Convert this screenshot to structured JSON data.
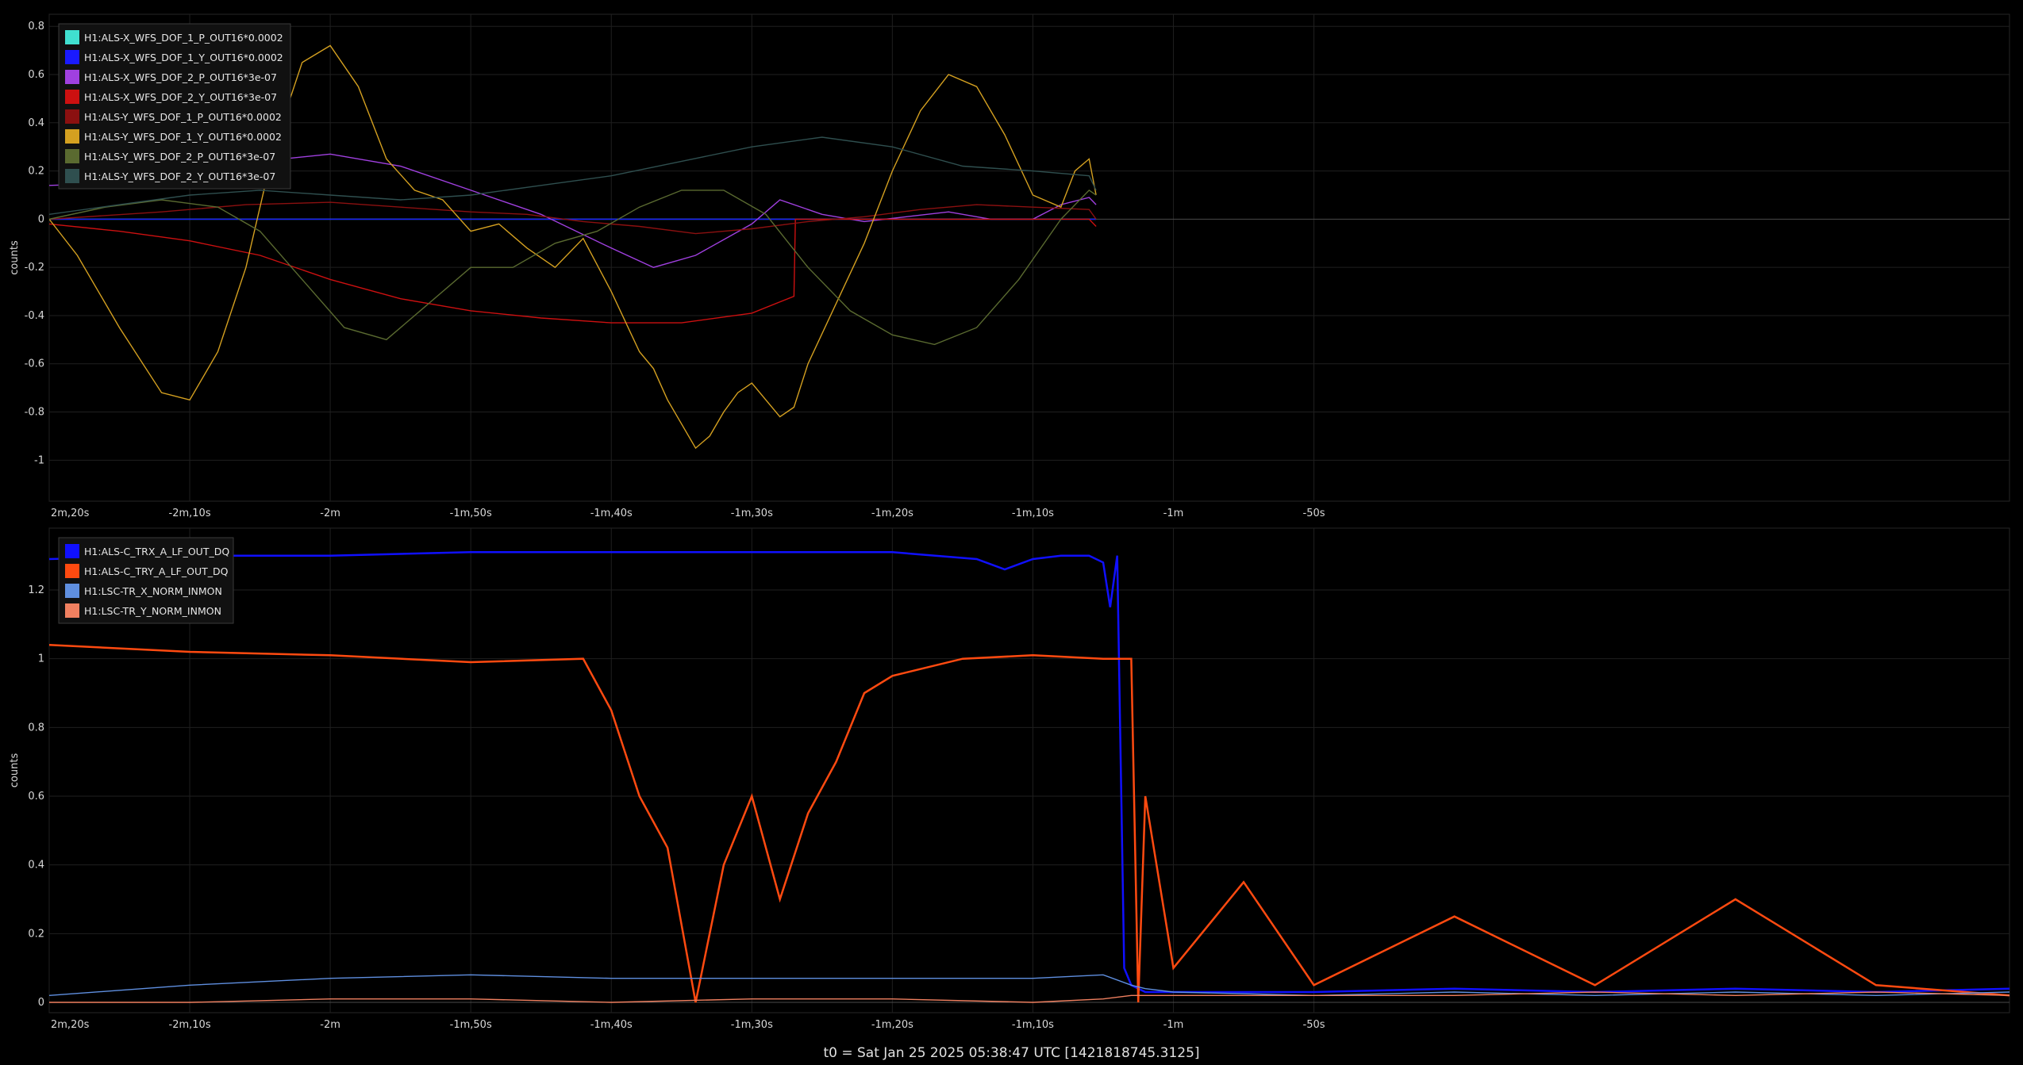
{
  "footer": {
    "t0": "t0 = Sat Jan 25 2025 05:38:47 UTC [1421818745.3125]"
  },
  "colors": {
    "background": "#000000",
    "grid": "#1f1f1f",
    "zero_line": "#4a4a4a",
    "axis_text": "#d8d8d8",
    "legend_bg": "#111111",
    "legend_border": "#3a3a3a"
  },
  "chart_data": [
    {
      "type": "line",
      "title": "",
      "ylabel": "counts",
      "xlim": [
        -140,
        -0.5
      ],
      "ylim": [
        -1.17,
        0.85
      ],
      "x_ticks": [
        -140,
        -130,
        -120,
        -110,
        -100,
        -90,
        -80,
        -70,
        -60,
        -50
      ],
      "x_tick_labels": [
        "2m,20s",
        "-2m,10s",
        "-2m",
        "-1m,50s",
        "-1m,40s",
        "-1m,30s",
        "-1m,20s",
        "-1m,10s",
        "-1m",
        "-50s"
      ],
      "y_ticks": [
        0.8,
        0.6,
        0.4,
        0.2,
        0,
        -0.2,
        -0.4,
        -0.6,
        -0.8,
        -1
      ],
      "y_tick_labels": [
        "0.8",
        "0.6",
        "0.4",
        "0.2",
        "0",
        "-0.2",
        "-0.4",
        "-0.6",
        "-0.8",
        "-1"
      ],
      "grid": true,
      "legend_position": "top-left",
      "series": [
        {
          "name": "H1:ALS-X_WFS_DOF_1_P_OUT16*0.0002",
          "color": "#40e0d0",
          "x": [
            -140,
            -65.5
          ],
          "y": [
            0.0,
            0.0
          ]
        },
        {
          "name": "H1:ALS-X_WFS_DOF_1_Y_OUT16*0.0002",
          "color": "#1a1aff",
          "x": [
            -140,
            -65.5
          ],
          "y": [
            0.0,
            0.0
          ]
        },
        {
          "name": "H1:ALS-X_WFS_DOF_2_P_OUT16*3e-07",
          "color": "#a040e0",
          "x": [
            -140,
            -135,
            -130,
            -125,
            -120,
            -115,
            -110,
            -105,
            -100,
            -97,
            -94,
            -90,
            -88,
            -85,
            -82,
            -79,
            -76,
            -73,
            -70,
            -68,
            -66,
            -65.5
          ],
          "y": [
            0.14,
            0.15,
            0.19,
            0.24,
            0.27,
            0.22,
            0.12,
            0.02,
            -0.12,
            -0.2,
            -0.15,
            -0.02,
            0.08,
            0.02,
            -0.01,
            0.01,
            0.03,
            0.0,
            0.0,
            0.06,
            0.09,
            0.06
          ]
        },
        {
          "name": "H1:ALS-X_WFS_DOF_2_Y_OUT16*3e-07",
          "color": "#cc1010",
          "x": [
            -140,
            -135,
            -130,
            -125,
            -120,
            -115,
            -110,
            -105,
            -100,
            -95,
            -90,
            -87,
            -86.9,
            -82,
            -78,
            -74,
            -70,
            -66,
            -65.5
          ],
          "y": [
            -0.02,
            -0.05,
            -0.09,
            -0.15,
            -0.25,
            -0.33,
            -0.38,
            -0.41,
            -0.43,
            -0.43,
            -0.39,
            -0.32,
            0.0,
            0.0,
            0.0,
            0.0,
            0.0,
            0.0,
            -0.03
          ]
        },
        {
          "name": "H1:ALS-Y_WFS_DOF_1_P_OUT16*0.0002",
          "color": "#8b1010",
          "x": [
            -140,
            -132,
            -126,
            -120,
            -115,
            -110,
            -106,
            -102,
            -98,
            -94,
            -90,
            -86,
            -82,
            -78,
            -74,
            -70,
            -66,
            -65.5
          ],
          "y": [
            0.0,
            0.03,
            0.06,
            0.07,
            0.05,
            0.03,
            0.02,
            -0.01,
            -0.03,
            -0.06,
            -0.04,
            -0.01,
            0.01,
            0.04,
            0.06,
            0.05,
            0.04,
            0.0
          ]
        },
        {
          "name": "H1:ALS-Y_WFS_DOF_1_Y_OUT16*0.0002",
          "color": "#d4a020",
          "x": [
            -140,
            -138,
            -135,
            -132,
            -130,
            -128,
            -126,
            -124,
            -122,
            -120,
            -118,
            -116,
            -114,
            -112,
            -110,
            -108,
            -106,
            -104,
            -102,
            -100,
            -98,
            -97,
            -96,
            -95,
            -94,
            -93,
            -92,
            -91,
            -90,
            -89,
            -88,
            -87,
            -86,
            -84,
            -82,
            -80,
            -78,
            -76,
            -74,
            -72,
            -70,
            -68,
            -67,
            -66,
            -65.5
          ],
          "y": [
            0.0,
            -0.15,
            -0.45,
            -0.72,
            -0.75,
            -0.55,
            -0.2,
            0.3,
            0.65,
            0.72,
            0.55,
            0.25,
            0.12,
            0.08,
            -0.05,
            -0.02,
            -0.12,
            -0.2,
            -0.08,
            -0.3,
            -0.55,
            -0.62,
            -0.75,
            -0.85,
            -0.95,
            -0.9,
            -0.8,
            -0.72,
            -0.68,
            -0.75,
            -0.82,
            -0.78,
            -0.6,
            -0.35,
            -0.1,
            0.2,
            0.45,
            0.6,
            0.55,
            0.35,
            0.1,
            0.05,
            0.2,
            0.25,
            0.1
          ]
        },
        {
          "name": "H1:ALS-Y_WFS_DOF_2_P_OUT16*3e-07",
          "color": "#5a6a30",
          "x": [
            -140,
            -136,
            -132,
            -128,
            -125,
            -122,
            -119,
            -116,
            -113,
            -110,
            -107,
            -104,
            -101,
            -98,
            -95,
            -92,
            -89,
            -86,
            -83,
            -80,
            -77,
            -74,
            -71,
            -68,
            -66,
            -65.5
          ],
          "y": [
            0.0,
            0.05,
            0.08,
            0.05,
            -0.05,
            -0.25,
            -0.45,
            -0.5,
            -0.35,
            -0.2,
            -0.2,
            -0.1,
            -0.05,
            0.05,
            0.12,
            0.12,
            0.02,
            -0.2,
            -0.38,
            -0.48,
            -0.52,
            -0.45,
            -0.25,
            0.0,
            0.12,
            0.1
          ]
        },
        {
          "name": "H1:ALS-Y_WFS_DOF_2_Y_OUT16*3e-07",
          "color": "#2f4f4f",
          "x": [
            -140,
            -135,
            -130,
            -125,
            -120,
            -115,
            -110,
            -105,
            -100,
            -95,
            -90,
            -85,
            -80,
            -75,
            -70,
            -66,
            -65.5
          ],
          "y": [
            0.02,
            0.06,
            0.1,
            0.12,
            0.1,
            0.08,
            0.1,
            0.14,
            0.18,
            0.24,
            0.3,
            0.34,
            0.3,
            0.22,
            0.2,
            0.18,
            0.12
          ]
        }
      ]
    },
    {
      "type": "line",
      "title": "",
      "ylabel": "counts",
      "xlim": [
        -140,
        -0.5
      ],
      "ylim": [
        -0.03,
        1.38
      ],
      "x_ticks": [
        -140,
        -130,
        -120,
        -110,
        -100,
        -90,
        -80,
        -70,
        -60,
        -50
      ],
      "x_tick_labels": [
        "2m,20s",
        "-2m,10s",
        "-2m",
        "-1m,50s",
        "-1m,40s",
        "-1m,30s",
        "-1m,20s",
        "-1m,10s",
        "-1m",
        "-50s"
      ],
      "y_ticks": [
        1.2,
        1,
        0.8,
        0.6,
        0.4,
        0.2,
        0
      ],
      "y_tick_labels": [
        "1.2",
        "1",
        "0.8",
        "0.6",
        "0.4",
        "0.2",
        "0"
      ],
      "grid": true,
      "legend_position": "top-left",
      "series": [
        {
          "name": "H1:ALS-C_TRX_A_LF_OUT_DQ",
          "color": "#1010ff",
          "x": [
            -140,
            -130,
            -120,
            -110,
            -100,
            -90,
            -80,
            -74,
            -72,
            -70,
            -68,
            -66,
            -65,
            -64.5,
            -64,
            -63.5,
            -63,
            -62,
            -60,
            -50,
            -40,
            -30,
            -20,
            -10,
            -0.5
          ],
          "y": [
            1.29,
            1.3,
            1.3,
            1.31,
            1.31,
            1.31,
            1.31,
            1.29,
            1.26,
            1.29,
            1.3,
            1.3,
            1.28,
            1.15,
            1.3,
            0.1,
            0.05,
            0.03,
            0.03,
            0.03,
            0.04,
            0.03,
            0.04,
            0.03,
            0.04
          ]
        },
        {
          "name": "H1:ALS-C_TRY_A_LF_OUT_DQ",
          "color": "#ff4a10",
          "x": [
            -140,
            -130,
            -120,
            -110,
            -102,
            -100,
            -98,
            -96,
            -94,
            -92,
            -90,
            -88,
            -86,
            -84,
            -82,
            -80,
            -75,
            -70,
            -65,
            -63,
            -62.5,
            -62,
            -60,
            -55,
            -50,
            -40,
            -30,
            -20,
            -10,
            -0.5
          ],
          "y": [
            1.04,
            1.02,
            1.01,
            0.99,
            1.0,
            0.85,
            0.6,
            0.45,
            0.0,
            0.4,
            0.6,
            0.3,
            0.55,
            0.7,
            0.9,
            0.95,
            1.0,
            1.01,
            1.0,
            1.0,
            0.0,
            0.6,
            0.1,
            0.35,
            0.05,
            0.25,
            0.05,
            0.3,
            0.05,
            0.02
          ]
        },
        {
          "name": "H1:LSC-TR_X_NORM_INMON",
          "color": "#5f8fe0",
          "x": [
            -140,
            -130,
            -120,
            -110,
            -100,
            -90,
            -80,
            -70,
            -65,
            -63,
            -62,
            -60,
            -50,
            -40,
            -30,
            -20,
            -10,
            -0.5
          ],
          "y": [
            0.02,
            0.05,
            0.07,
            0.08,
            0.07,
            0.07,
            0.07,
            0.07,
            0.08,
            0.05,
            0.04,
            0.03,
            0.02,
            0.03,
            0.02,
            0.03,
            0.02,
            0.03
          ]
        },
        {
          "name": "H1:LSC-TR_Y_NORM_INMON",
          "color": "#f08060",
          "x": [
            -140,
            -130,
            -120,
            -110,
            -100,
            -90,
            -80,
            -70,
            -65,
            -63,
            -60,
            -50,
            -40,
            -30,
            -20,
            -10,
            -0.5
          ],
          "y": [
            0.0,
            0.0,
            0.01,
            0.01,
            0.0,
            0.01,
            0.01,
            0.0,
            0.01,
            0.02,
            0.02,
            0.02,
            0.02,
            0.03,
            0.02,
            0.03,
            0.02
          ]
        }
      ]
    }
  ]
}
